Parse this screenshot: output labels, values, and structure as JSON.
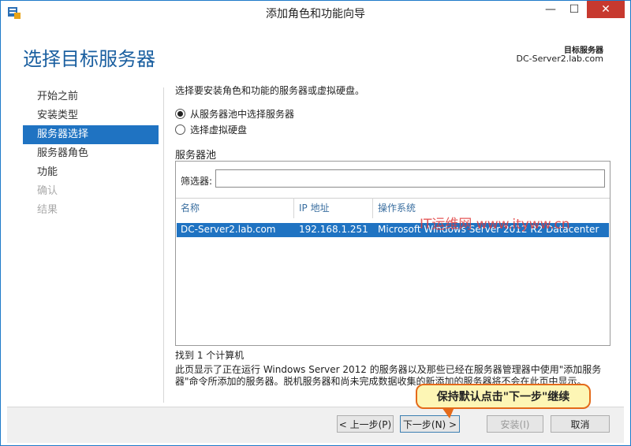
{
  "window": {
    "title": "添加角色和功能向导",
    "min_glyph": "—",
    "max_glyph": "☐",
    "close_glyph": "✕"
  },
  "header": {
    "page_title": "选择目标服务器",
    "target_label": "目标服务器",
    "target_server": "DC-Server2.lab.com"
  },
  "nav": {
    "items": [
      {
        "label": "开始之前",
        "state": "normal"
      },
      {
        "label": "安装类型",
        "state": "normal"
      },
      {
        "label": "服务器选择",
        "state": "active"
      },
      {
        "label": "服务器角色",
        "state": "normal"
      },
      {
        "label": "功能",
        "state": "normal"
      },
      {
        "label": "确认",
        "state": "disabled"
      },
      {
        "label": "结果",
        "state": "disabled"
      }
    ]
  },
  "main": {
    "intro": "选择要安装角色和功能的服务器或虚拟硬盘。",
    "options": [
      {
        "label": "从服务器池中选择服务器",
        "checked": true
      },
      {
        "label": "选择虚拟硬盘",
        "checked": false
      }
    ],
    "pool_title": "服务器池",
    "filter_label": "筛选器:",
    "filter_value": "",
    "columns": [
      "名称",
      "IP 地址",
      "操作系统"
    ],
    "rows": [
      {
        "name": "DC-Server2.lab.com",
        "ip": "192.168.1.251",
        "os": "Microsoft Windows Server 2012 R2 Datacenter",
        "selected": true
      }
    ],
    "found": "找到 1 个计算机",
    "description": "此页显示了正在运行 Windows Server 2012 的服务器以及那些已经在服务器管理器中使用\"添加服务器\"命令所添加的服务器。脱机服务器和尚未完成数据收集的新添加的服务器将不会在此页中显示。"
  },
  "footer": {
    "prev": "< 上一步(P)",
    "next": "下一步(N) >",
    "install": "安装(I)",
    "cancel": "取消"
  },
  "overlay": {
    "watermark": "IT运维网 www.ityww.cn",
    "callout": "保持默认点击\"下一步\"继续"
  },
  "colors": {
    "accent": "#1f73c2",
    "title_blue": "#1a5fa0",
    "close_red": "#c7392f",
    "callout_border": "#e46a1a",
    "callout_fill": "#fdf6b5"
  }
}
